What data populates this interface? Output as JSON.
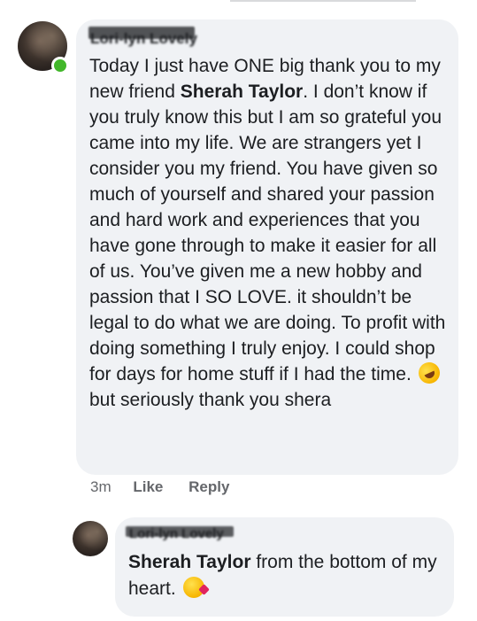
{
  "comment": {
    "author": "Lori-lyn Lovely",
    "online": true,
    "text_part1": "Today I just have ONE big thank you to my new friend ",
    "mention": "Sherah Taylor",
    "text_part2": ". I don’t know if you truly know this but I am so grateful you came into my life. We are strangers yet I consider you my friend. You have given so much of yourself and shared your passion and hard work and experiences that you have gone through to make it easier for all of us. You’ve given me a new hobby and passion that I SO LOVE. it shouldn’t be legal to do what we are doing. To profit with doing something I truly enjoy. I could shop for days for home stuff if I had the time.",
    "emoji": "rolling-on-floor-laughing-emoji",
    "text_part3": " but seriously thank you shera",
    "time": "3m",
    "like_label": "Like",
    "reply_label": "Reply"
  },
  "reply": {
    "author": "Lori-lyn Lovely",
    "mention": "Sherah Taylor",
    "text": " from the bottom of my heart.",
    "emoji": "face-blowing-kiss-emoji"
  },
  "colors": {
    "bubble": "#f0f2f5",
    "text": "#1c1e21",
    "meta": "#65676b",
    "online": "#42b72a"
  }
}
